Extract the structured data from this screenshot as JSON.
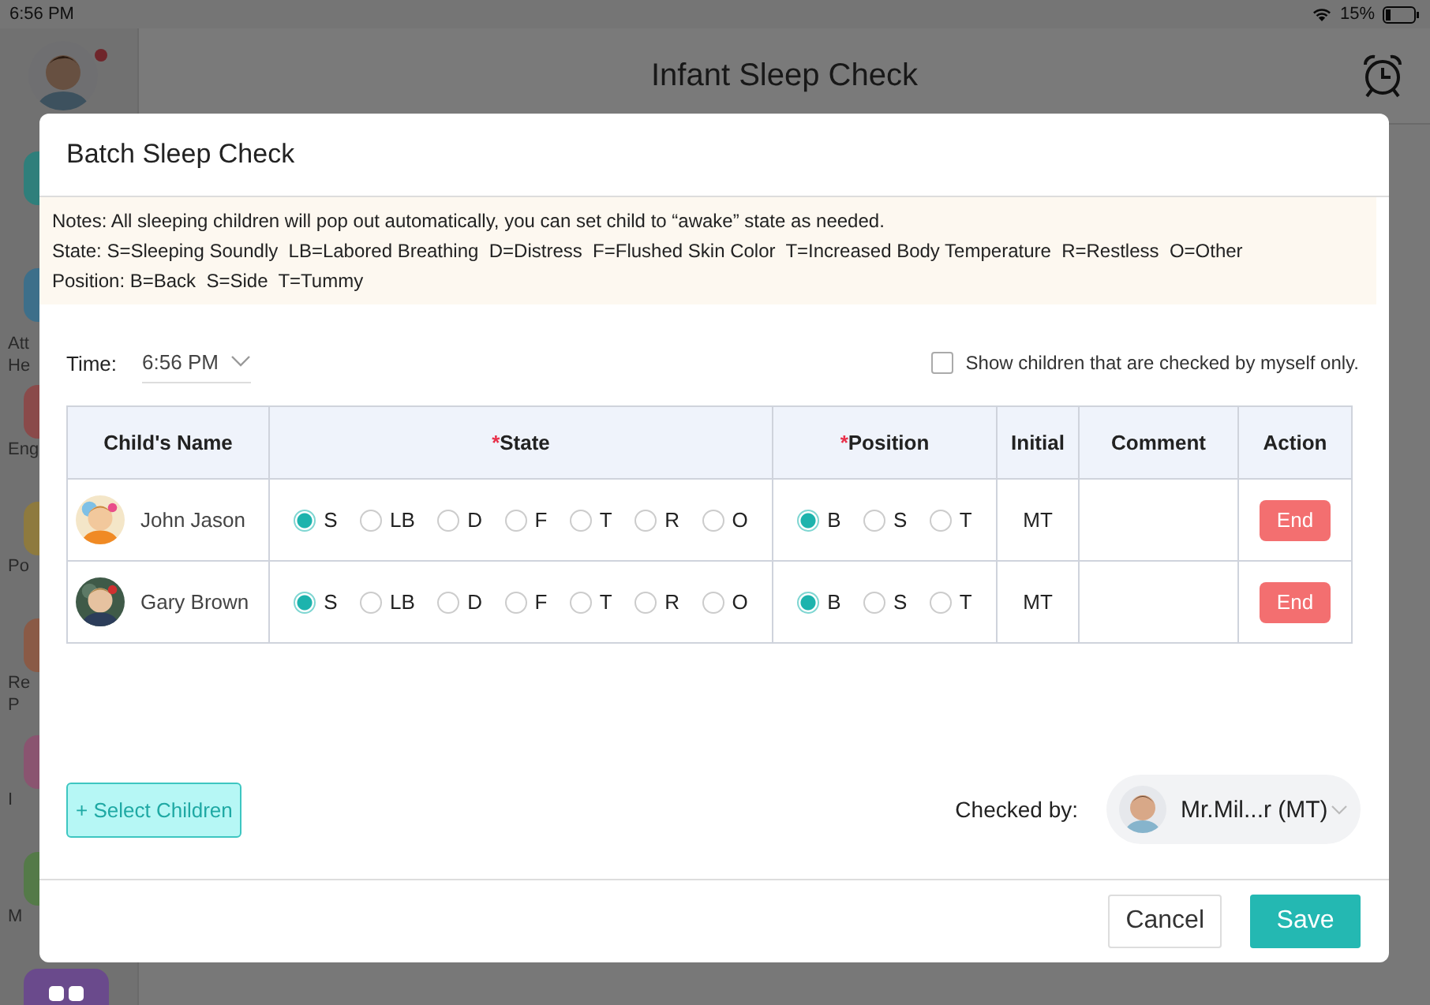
{
  "status_bar": {
    "time": "6:56 PM",
    "battery": "15%"
  },
  "sidebar": {
    "items": [
      {
        "color": "#2f7f7b"
      },
      {
        "color": "#3d6f8a",
        "label_lines": [
          "Att",
          "He"
        ]
      },
      {
        "color": "#8a4a4a",
        "label_lines": [
          "Eng"
        ]
      },
      {
        "color": "#8e7a3e",
        "label_lines": [
          "Po"
        ]
      },
      {
        "color": "#8a5a46",
        "label_lines": [
          "Re",
          "P"
        ]
      },
      {
        "color": "#8a5470",
        "label_lines": [
          "I"
        ]
      },
      {
        "color": "#547a48",
        "label_lines": [
          "M"
        ]
      },
      {
        "color": "#6a4a8c",
        "kind": "apps"
      }
    ]
  },
  "header": {
    "title": "Infant Sleep Check"
  },
  "dialog": {
    "title": "Batch Sleep Check",
    "notes": [
      "Notes: All sleeping children will pop out automatically, you can set child to “awake” state as needed.",
      "State: S=Sleeping Soundly  LB=Labored Breathing  D=Distress  F=Flushed Skin Color  T=Increased Body Temperature  R=Restless  O=Other",
      "Position: B=Back  S=Side  T=Tummy"
    ],
    "time": {
      "label": "Time:",
      "value": "6:56 PM"
    },
    "my_only": {
      "label": "Show children that are checked by myself only.",
      "checked": false
    },
    "table": {
      "columns": [
        {
          "label": "Child's Name"
        },
        {
          "label": "State",
          "required_mark": "*"
        },
        {
          "label": "Position",
          "required_mark": "*"
        },
        {
          "label": "Initial"
        },
        {
          "label": "Comment"
        },
        {
          "label": "Action"
        }
      ],
      "rows": [
        {
          "name": "John Jason",
          "state": [
            {
              "label": "S",
              "selected": true
            },
            {
              "label": "LB",
              "selected": false
            },
            {
              "label": "D",
              "selected": false
            },
            {
              "label": "F",
              "selected": false
            },
            {
              "label": "T",
              "selected": false
            },
            {
              "label": "R",
              "selected": false
            },
            {
              "label": "O",
              "selected": false
            }
          ],
          "position": [
            {
              "label": "B",
              "selected": true
            },
            {
              "label": "S",
              "selected": false
            },
            {
              "label": "T",
              "selected": false
            }
          ],
          "initial": "MT",
          "action": "End"
        },
        {
          "name": "Gary Brown",
          "state": [
            {
              "label": "S",
              "selected": true
            },
            {
              "label": "LB",
              "selected": false
            },
            {
              "label": "D",
              "selected": false
            },
            {
              "label": "F",
              "selected": false
            },
            {
              "label": "T",
              "selected": false
            },
            {
              "label": "R",
              "selected": false
            },
            {
              "label": "O",
              "selected": false
            }
          ],
          "position": [
            {
              "label": "B",
              "selected": true
            },
            {
              "label": "S",
              "selected": false
            },
            {
              "label": "T",
              "selected": false
            }
          ],
          "initial": "MT",
          "action": "End"
        }
      ]
    },
    "select_button": "+ Select Children",
    "checked_by": {
      "label": "Checked by:",
      "value": "Mr.Mil...r (MT)"
    },
    "buttons": [
      {
        "label": "Cancel",
        "kind": "secondary"
      },
      {
        "label": "Save",
        "kind": "primary"
      }
    ]
  }
}
